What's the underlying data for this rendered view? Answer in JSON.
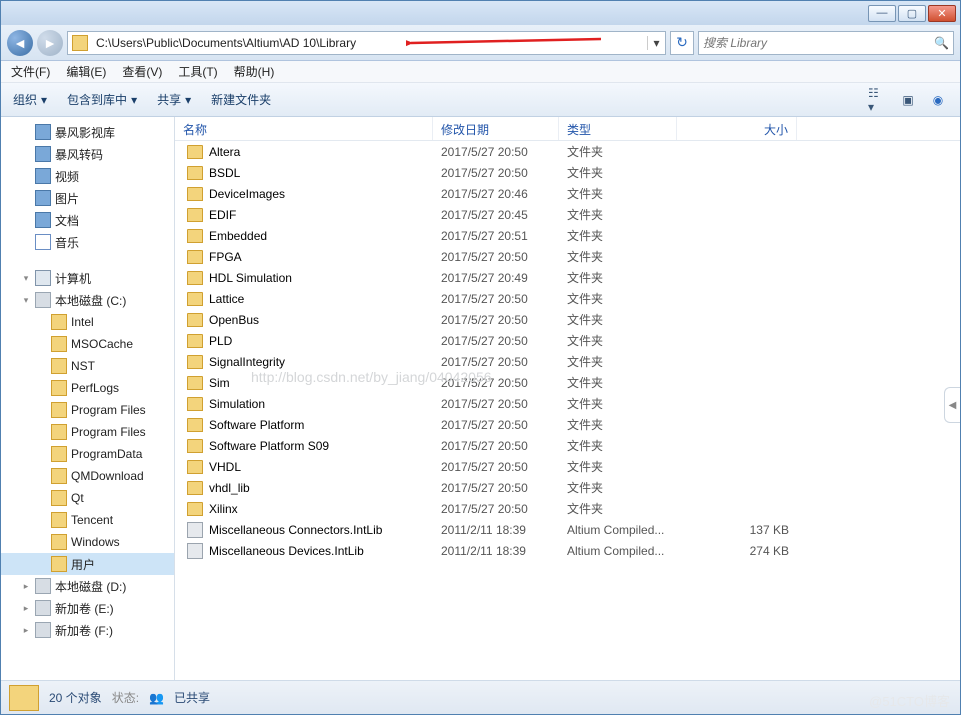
{
  "titlebar": {
    "min": "—",
    "max": "▢",
    "close": "✕"
  },
  "address": {
    "path": "C:\\Users\\Public\\Documents\\Altium\\AD 10\\Library",
    "search_placeholder": "搜索 Library"
  },
  "menu": {
    "file": "文件(F)",
    "edit": "编辑(E)",
    "view": "查看(V)",
    "tools": "工具(T)",
    "help": "帮助(H)"
  },
  "toolbar": {
    "organize": "组织",
    "include": "包含到库中",
    "share": "共享",
    "newfolder": "新建文件夹"
  },
  "tree": [
    {
      "lvl": 1,
      "icon": "blue-ico",
      "label": "暴风影视库",
      "arrow": ""
    },
    {
      "lvl": 1,
      "icon": "blue-ico",
      "label": "暴风转码",
      "arrow": ""
    },
    {
      "lvl": 1,
      "icon": "blue-ico",
      "label": "视频",
      "arrow": ""
    },
    {
      "lvl": 1,
      "icon": "blue-ico",
      "label": "图片",
      "arrow": ""
    },
    {
      "lvl": 1,
      "icon": "blue-ico",
      "label": "文档",
      "arrow": ""
    },
    {
      "lvl": 1,
      "icon": "music-ico",
      "label": "音乐",
      "arrow": ""
    },
    {
      "lvl": 0,
      "spacer": true
    },
    {
      "lvl": 0,
      "icon": "computer-ico",
      "label": "计算机",
      "arrow": "▾"
    },
    {
      "lvl": 1,
      "icon": "disk-ico",
      "label": "本地磁盘 (C:)",
      "arrow": "▾"
    },
    {
      "lvl": 2,
      "icon": "tree-ico",
      "label": "Intel",
      "arrow": ""
    },
    {
      "lvl": 2,
      "icon": "tree-ico",
      "label": "MSOCache",
      "arrow": ""
    },
    {
      "lvl": 2,
      "icon": "tree-ico",
      "label": "NST",
      "arrow": ""
    },
    {
      "lvl": 2,
      "icon": "tree-ico",
      "label": "PerfLogs",
      "arrow": ""
    },
    {
      "lvl": 2,
      "icon": "tree-ico",
      "label": "Program Files",
      "arrow": ""
    },
    {
      "lvl": 2,
      "icon": "tree-ico",
      "label": "Program Files",
      "arrow": ""
    },
    {
      "lvl": 2,
      "icon": "tree-ico",
      "label": "ProgramData",
      "arrow": ""
    },
    {
      "lvl": 2,
      "icon": "tree-ico",
      "label": "QMDownload",
      "arrow": ""
    },
    {
      "lvl": 2,
      "icon": "tree-ico",
      "label": "Qt",
      "arrow": ""
    },
    {
      "lvl": 2,
      "icon": "tree-ico",
      "label": "Tencent",
      "arrow": ""
    },
    {
      "lvl": 2,
      "icon": "tree-ico",
      "label": "Windows",
      "arrow": ""
    },
    {
      "lvl": 2,
      "icon": "tree-ico",
      "label": "用户",
      "arrow": "",
      "selected": true
    },
    {
      "lvl": 1,
      "icon": "disk-ico",
      "label": "本地磁盘 (D:)",
      "arrow": "▸"
    },
    {
      "lvl": 1,
      "icon": "disk-ico",
      "label": "新加卷 (E:)",
      "arrow": "▸"
    },
    {
      "lvl": 1,
      "icon": "disk-ico",
      "label": "新加卷 (F:)",
      "arrow": "▸"
    }
  ],
  "columns": {
    "name": "名称",
    "date": "修改日期",
    "type": "类型",
    "size": "大小"
  },
  "files": [
    {
      "icon": "folder",
      "name": "Altera",
      "date": "2017/5/27 20:50",
      "type": "文件夹",
      "size": ""
    },
    {
      "icon": "folder",
      "name": "BSDL",
      "date": "2017/5/27 20:50",
      "type": "文件夹",
      "size": ""
    },
    {
      "icon": "folder",
      "name": "DeviceImages",
      "date": "2017/5/27 20:46",
      "type": "文件夹",
      "size": ""
    },
    {
      "icon": "folder",
      "name": "EDIF",
      "date": "2017/5/27 20:45",
      "type": "文件夹",
      "size": ""
    },
    {
      "icon": "folder",
      "name": "Embedded",
      "date": "2017/5/27 20:51",
      "type": "文件夹",
      "size": ""
    },
    {
      "icon": "folder",
      "name": "FPGA",
      "date": "2017/5/27 20:50",
      "type": "文件夹",
      "size": ""
    },
    {
      "icon": "folder",
      "name": "HDL Simulation",
      "date": "2017/5/27 20:49",
      "type": "文件夹",
      "size": ""
    },
    {
      "icon": "folder",
      "name": "Lattice",
      "date": "2017/5/27 20:50",
      "type": "文件夹",
      "size": ""
    },
    {
      "icon": "folder",
      "name": "OpenBus",
      "date": "2017/5/27 20:50",
      "type": "文件夹",
      "size": ""
    },
    {
      "icon": "folder",
      "name": "PLD",
      "date": "2017/5/27 20:50",
      "type": "文件夹",
      "size": ""
    },
    {
      "icon": "folder",
      "name": "SignalIntegrity",
      "date": "2017/5/27 20:50",
      "type": "文件夹",
      "size": ""
    },
    {
      "icon": "folder",
      "name": "Sim",
      "date": "2017/5/27 20:50",
      "type": "文件夹",
      "size": ""
    },
    {
      "icon": "folder",
      "name": "Simulation",
      "date": "2017/5/27 20:50",
      "type": "文件夹",
      "size": ""
    },
    {
      "icon": "folder",
      "name": "Software Platform",
      "date": "2017/5/27 20:50",
      "type": "文件夹",
      "size": ""
    },
    {
      "icon": "folder",
      "name": "Software Platform S09",
      "date": "2017/5/27 20:50",
      "type": "文件夹",
      "size": ""
    },
    {
      "icon": "folder",
      "name": "VHDL",
      "date": "2017/5/27 20:50",
      "type": "文件夹",
      "size": ""
    },
    {
      "icon": "folder",
      "name": "vhdl_lib",
      "date": "2017/5/27 20:50",
      "type": "文件夹",
      "size": ""
    },
    {
      "icon": "folder",
      "name": "Xilinx",
      "date": "2017/5/27 20:50",
      "type": "文件夹",
      "size": ""
    },
    {
      "icon": "intlib",
      "name": "Miscellaneous Connectors.IntLib",
      "date": "2011/2/11 18:39",
      "type": "Altium Compiled...",
      "size": "137 KB"
    },
    {
      "icon": "intlib",
      "name": "Miscellaneous Devices.IntLib",
      "date": "2011/2/11 18:39",
      "type": "Altium Compiled...",
      "size": "274 KB"
    }
  ],
  "status": {
    "count": "20 个对象",
    "state_label": "状态:",
    "state_value": "已共享"
  },
  "watermark_center": "http://blog.csdn.net/by_jiang/04042056",
  "watermark_corner": "@51CTO博客"
}
